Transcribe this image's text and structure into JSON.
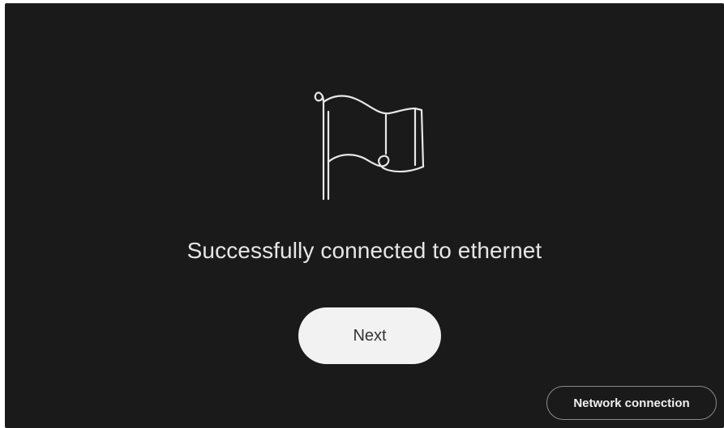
{
  "main": {
    "icon": "flag-icon",
    "message": "Successfully connected to ethernet",
    "next_label": "Next"
  },
  "footer": {
    "network_label": "Network connection"
  },
  "colors": {
    "background": "#1a1a1a",
    "text": "#e6e6e6",
    "primary_button": "#f2f2f2",
    "secondary_border": "#8a8a8a"
  }
}
